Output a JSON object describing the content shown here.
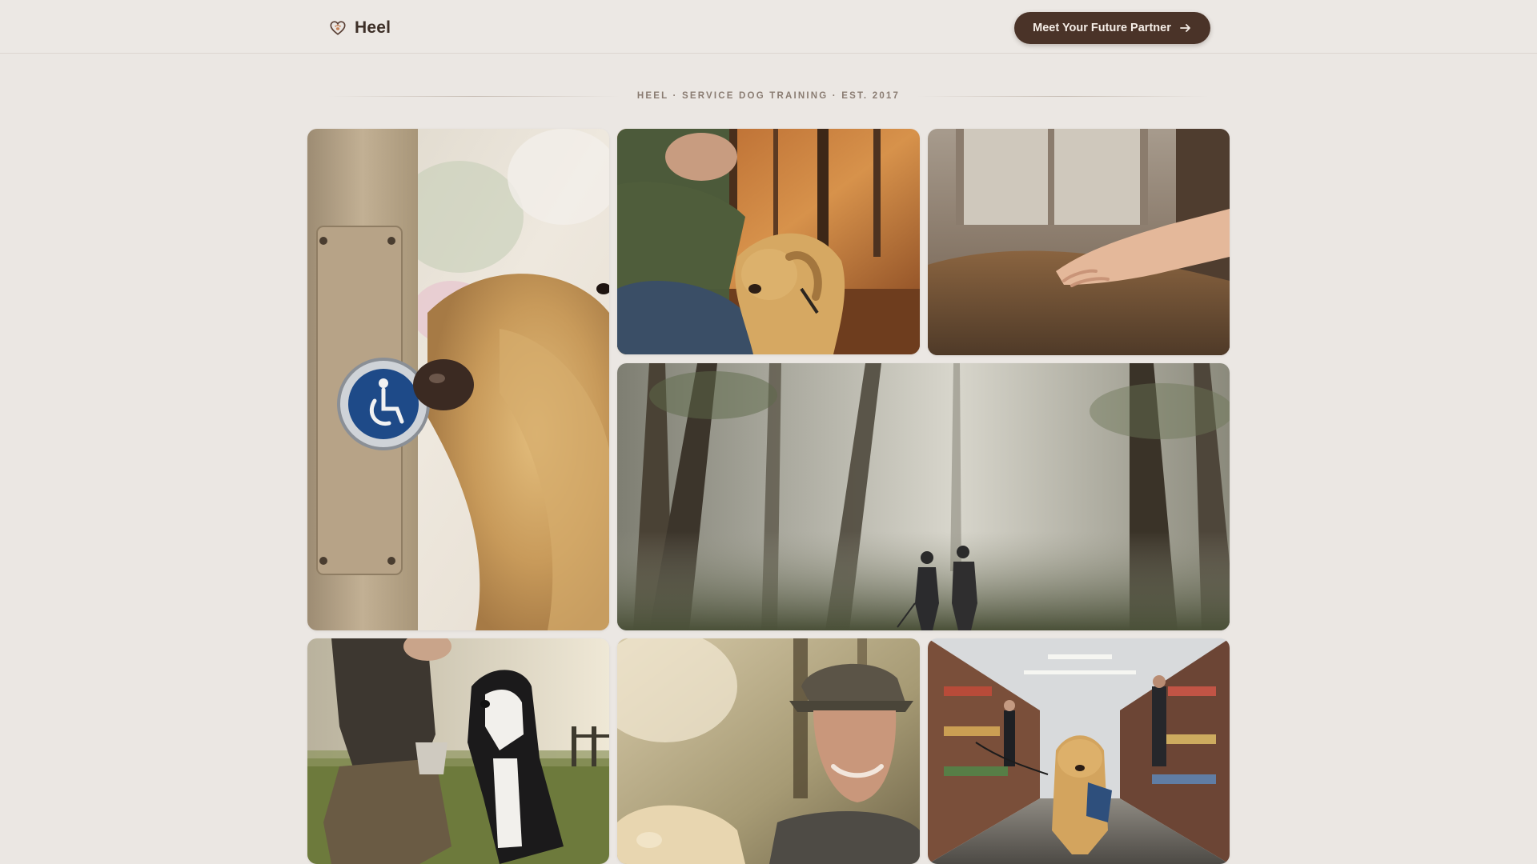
{
  "header": {
    "brand_name": "Heel",
    "brand_icon": "heart-paw-icon",
    "cta_label": "Meet Your Future Partner",
    "cta_icon": "arrow-right-icon"
  },
  "tagline": "HEEL · SERVICE DOG TRAINING · EST. 2017",
  "colors": {
    "background": "#ebe7e3",
    "primary": "#4a3328",
    "brand_text": "#3d2f27",
    "muted_text": "#8a7c72"
  },
  "gallery": [
    {
      "name": "photo-golden-retriever-accessibility-button"
    },
    {
      "name": "photo-man-with-labrador-autumn-forest"
    },
    {
      "name": "photo-hand-petting-dog-fur"
    },
    {
      "name": "photo-couple-walking-dog-misty-forest"
    },
    {
      "name": "photo-trainer-with-border-collie"
    },
    {
      "name": "photo-smiling-man-with-dog"
    },
    {
      "name": "photo-service-dog-grocery-store"
    }
  ]
}
